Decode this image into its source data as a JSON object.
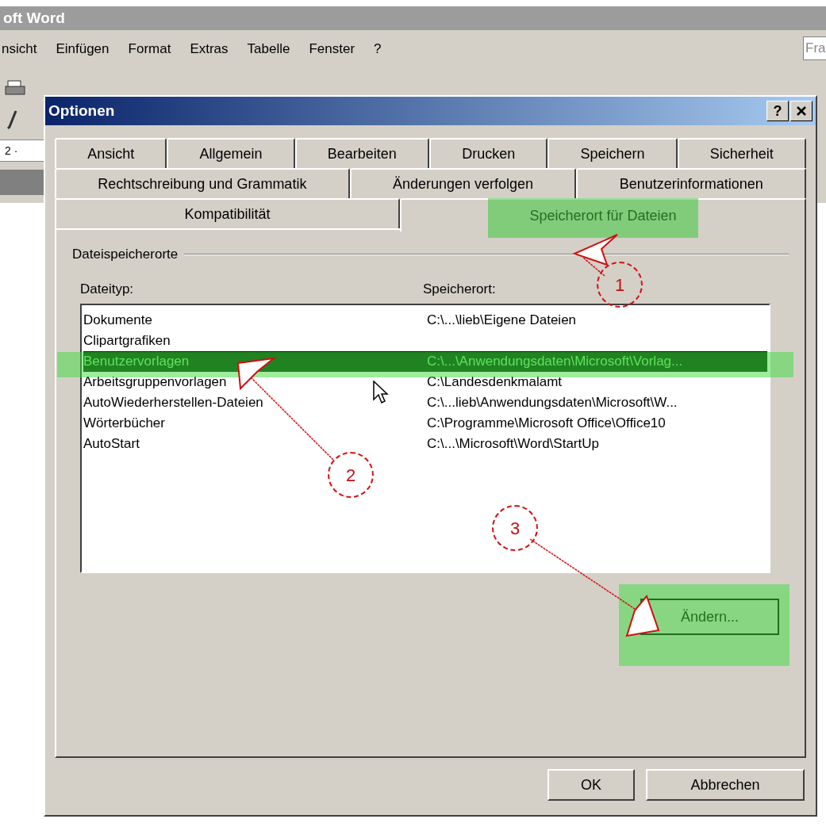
{
  "app": {
    "title": "oft Word",
    "menu": [
      "nsicht",
      "Einfügen",
      "Format",
      "Extras",
      "Tabelle",
      "Fenster",
      "?"
    ],
    "help_box": "Fra",
    "ruler_label": "2 ·"
  },
  "dialog": {
    "title": "Optionen",
    "help_button": "?",
    "tab_rows": [
      [
        {
          "label": "Ansicht",
          "selected": false
        },
        {
          "label": "Allgemein",
          "selected": false
        },
        {
          "label": "Bearbeiten",
          "selected": false
        },
        {
          "label": "Drucken",
          "selected": false
        },
        {
          "label": "Speichern",
          "selected": false
        },
        {
          "label": "Sicherheit",
          "selected": false
        }
      ],
      [
        {
          "label": "Rechtschreibung und Grammatik",
          "selected": false
        },
        {
          "label": "Änderungen verfolgen",
          "selected": false
        },
        {
          "label": "Benutzerinformationen",
          "selected": false
        }
      ],
      [
        {
          "label": "Kompatibilität",
          "selected": false
        },
        {
          "label": "Speicherort für Dateien",
          "selected": true
        }
      ]
    ],
    "group": "Dateispeicherorte",
    "columns": [
      "Dateityp:",
      "Speicherort:"
    ],
    "rows": [
      {
        "type": "Dokumente",
        "location": "C:\\...\\lieb\\Eigene Dateien",
        "selected": false
      },
      {
        "type": "Clipartgrafiken",
        "location": "",
        "selected": false
      },
      {
        "type": "Benutzervorlagen",
        "location": "C:\\...\\Anwendungsdaten\\Microsoft\\Vorlag...",
        "selected": true
      },
      {
        "type": "Arbeitsgruppenvorlagen",
        "location": "C:\\Landesdenkmalamt",
        "selected": false
      },
      {
        "type": "AutoWiederherstellen-Dateien",
        "location": "C:\\...lieb\\Anwendungsdaten\\Microsoft\\W...",
        "selected": false
      },
      {
        "type": "Wörterbücher",
        "location": "C:\\Programme\\Microsoft Office\\Office10",
        "selected": false
      },
      {
        "type": "AutoStart",
        "location": "C:\\...\\Microsoft\\Word\\StartUp",
        "selected": false
      }
    ],
    "modify_button": "Ändern...",
    "buttons": [
      "OK",
      "Abbrechen"
    ]
  },
  "annotations": [
    "1",
    "2",
    "3"
  ]
}
